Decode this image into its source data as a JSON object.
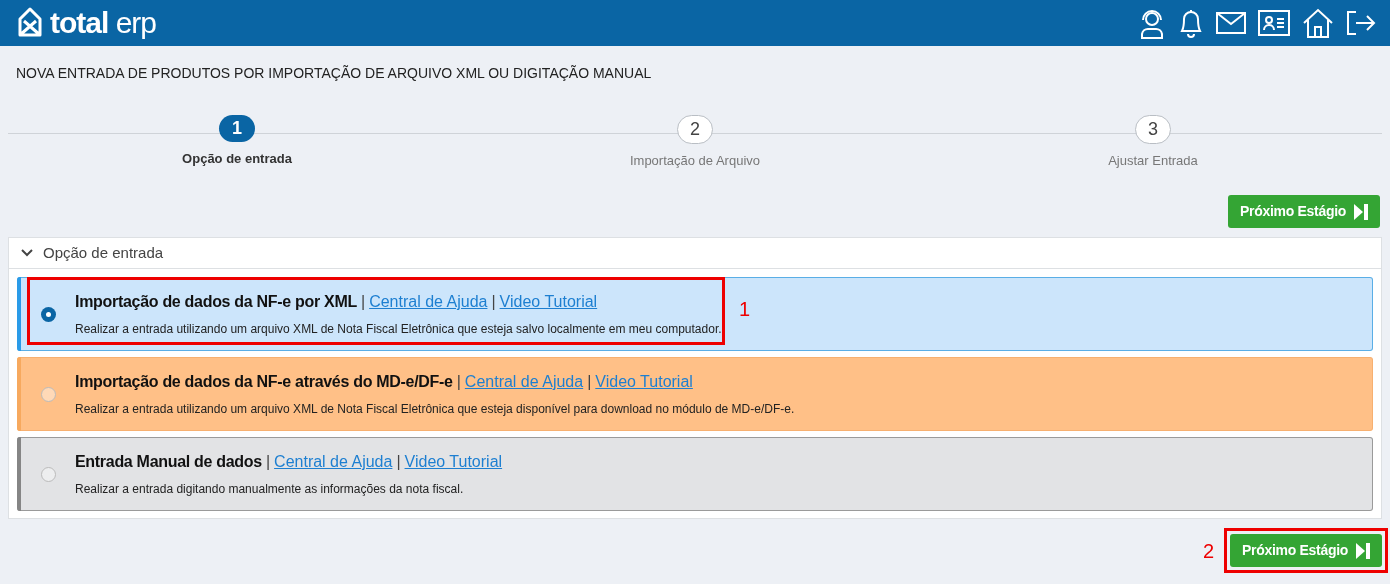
{
  "header": {
    "logo_bold": "total",
    "logo_light": "erp"
  },
  "page_title": "NOVA ENTRADA DE PRODUTOS POR IMPORTAÇÃO DE ARQUIVO XML OU DIGITAÇÃO MANUAL",
  "steps": [
    {
      "number": "1",
      "label": "Opção de entrada",
      "selected": true
    },
    {
      "number": "2",
      "label": "Importação de Arquivo",
      "selected": false
    },
    {
      "number": "3",
      "label": "Ajustar Entrada",
      "selected": false
    }
  ],
  "top_button": {
    "label": "Próximo Estágio"
  },
  "panel": {
    "title": "Opção de entrada",
    "expanded": true,
    "options": [
      {
        "title": "Importação de dados da NF-e por XML",
        "links": [
          {
            "separator": "|",
            "label": "Central de Ajuda"
          },
          {
            "separator": "|",
            "label": "Video Tutorial"
          }
        ],
        "description": "Realizar a entrada utilizando um arquivo XML de Nota Fiscal Eletrônica que esteja salvo localmente em meu computador.",
        "selected": true,
        "color": "#2a9be8",
        "callout": "1"
      },
      {
        "title": "Importação de dados da NF-e através do MD-e/DF-e",
        "links": [
          {
            "separator": "|",
            "label": "Central de Ajuda"
          },
          {
            "separator": "|",
            "label": "Video Tutorial"
          }
        ],
        "description": "Realizar a entrada utilizando um arquivo XML de Nota Fiscal Eletrônica que esteja disponível para download no módulo de MD-e/DF-e.",
        "selected": false,
        "color": "#f7a95e"
      },
      {
        "title": "Entrada Manual de dados",
        "links": [
          {
            "separator": "|",
            "label": "Central de Ajuda"
          },
          {
            "separator": "|",
            "label": "Video Tutorial"
          }
        ],
        "description": "Realizar a entrada digitando manualmente as informações da nota fiscal.",
        "selected": false,
        "color": "#858585"
      }
    ]
  },
  "bottom_button": {
    "label": "Próximo Estágio",
    "callout": "2"
  }
}
